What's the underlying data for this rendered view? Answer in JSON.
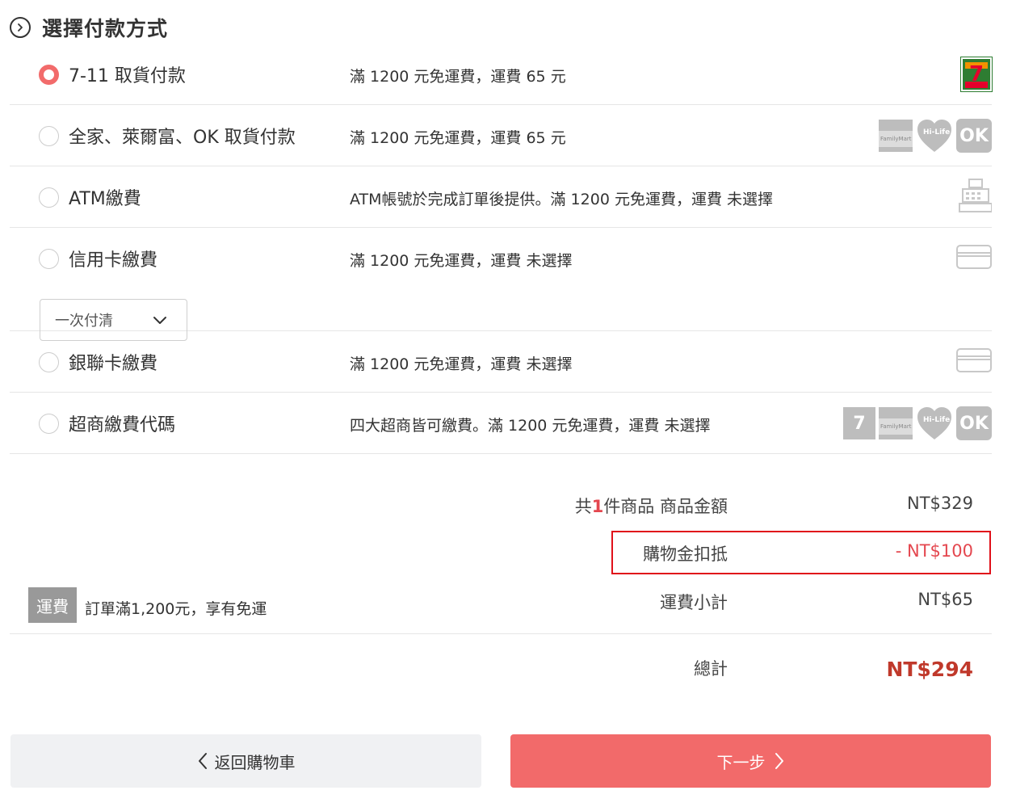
{
  "section": {
    "title": "選擇付款方式"
  },
  "payments": [
    {
      "name": "7-11 取貨付款",
      "desc": "滿 1200 元免運費，運費 65 元",
      "selected": true
    },
    {
      "name": "全家、萊爾富、OK 取貨付款",
      "desc": "滿 1200 元免運費，運費 65 元",
      "selected": false
    },
    {
      "name": "ATM繳費",
      "desc": "ATM帳號於完成訂單後提供。滿 1200 元免運費，運費 未選擇",
      "selected": false
    },
    {
      "name": "信用卡繳費",
      "desc": "滿 1200 元免運費，運費 未選擇",
      "selected": false,
      "installment": "一次付清"
    },
    {
      "name": "銀聯卡繳費",
      "desc": "滿 1200 元免運費，運費 未選擇",
      "selected": false
    },
    {
      "name": "超商繳費代碼",
      "desc": "四大超商皆可繳費。滿 1200 元免運費，運費 未選擇",
      "selected": false
    }
  ],
  "logos": {
    "familymart": "FamilyMart",
    "hilife": "Hi-Life",
    "ok": "OK",
    "seven": "7"
  },
  "summary": {
    "items_prefix": "共",
    "items_count": "1",
    "items_suffix": "件商品 商品金額",
    "subtotal": "NT$329",
    "credit_label": "購物金扣抵",
    "credit_value": "- NT$100",
    "shipping_label": "運費小計",
    "shipping_value": "NT$65",
    "total_label": "總計",
    "total_value": "NT$294"
  },
  "shipping_note": {
    "badge": "運費",
    "text": "訂單滿1,200元，享有免運"
  },
  "buttons": {
    "back": "返回購物車",
    "next": "下一步"
  },
  "colors": {
    "accent": "#f26a6a",
    "total": "#c0392b",
    "highlight": "#e0101a",
    "seven_green": "#2e7d32"
  }
}
